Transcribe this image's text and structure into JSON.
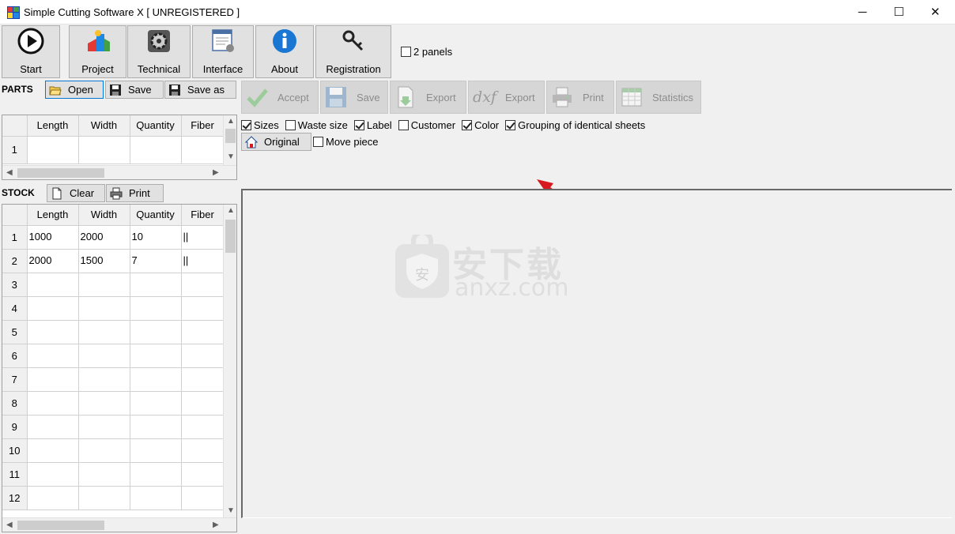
{
  "window": {
    "title": "Simple Cutting Software X [ UNREGISTERED ]",
    "minimize_glyph": "─",
    "maximize_glyph": "☐",
    "close_glyph": "✕"
  },
  "toolbar": {
    "start": "Start",
    "project": "Project",
    "technical": "Technical",
    "interface": "Interface",
    "about": "About",
    "registration": "Registration",
    "two_panels": "2 panels"
  },
  "parts": {
    "label": "PARTS",
    "open": "Open",
    "save": "Save",
    "save_as": "Save as",
    "columns": [
      "Length",
      "Width",
      "Quantity",
      "Fiber"
    ],
    "rows": [
      {
        "num": "1",
        "length": "",
        "width": "",
        "quantity": "",
        "fiber": ""
      }
    ]
  },
  "stock": {
    "label": "STOCK",
    "clear": "Clear",
    "print": "Print",
    "columns": [
      "Length",
      "Width",
      "Quantity",
      "Fiber"
    ],
    "rows": [
      {
        "num": "1",
        "length": "1000",
        "width": "2000",
        "quantity": "10",
        "fiber": "||"
      },
      {
        "num": "2",
        "length": "2000",
        "width": "1500",
        "quantity": "7",
        "fiber": "||"
      },
      {
        "num": "3",
        "length": "",
        "width": "",
        "quantity": "",
        "fiber": ""
      },
      {
        "num": "4",
        "length": "",
        "width": "",
        "quantity": "",
        "fiber": ""
      },
      {
        "num": "5",
        "length": "",
        "width": "",
        "quantity": "",
        "fiber": ""
      },
      {
        "num": "6",
        "length": "",
        "width": "",
        "quantity": "",
        "fiber": ""
      },
      {
        "num": "7",
        "length": "",
        "width": "",
        "quantity": "",
        "fiber": ""
      },
      {
        "num": "8",
        "length": "",
        "width": "",
        "quantity": "",
        "fiber": ""
      },
      {
        "num": "9",
        "length": "",
        "width": "",
        "quantity": "",
        "fiber": ""
      },
      {
        "num": "10",
        "length": "",
        "width": "",
        "quantity": "",
        "fiber": ""
      },
      {
        "num": "11",
        "length": "",
        "width": "",
        "quantity": "",
        "fiber": ""
      },
      {
        "num": "12",
        "length": "",
        "width": "",
        "quantity": "",
        "fiber": ""
      }
    ]
  },
  "result_toolbar": {
    "accept": "Accept",
    "save": "Save",
    "export": "Export",
    "export_dxf": "Export",
    "dxf_icon_text": "dxf",
    "print": "Print",
    "statistics": "Statistics"
  },
  "options": {
    "sizes": "Sizes",
    "waste_size": "Waste size",
    "label": "Label",
    "customer": "Customer",
    "color": "Color",
    "grouping": "Grouping of identical sheets",
    "original": "Original",
    "move_piece": "Move piece"
  },
  "watermark": {
    "cn": "安下载",
    "domain": "anxz.com",
    "badge_char": "安"
  },
  "colors": {
    "accent_red": "#d71920",
    "selection_blue": "#0078d7"
  }
}
